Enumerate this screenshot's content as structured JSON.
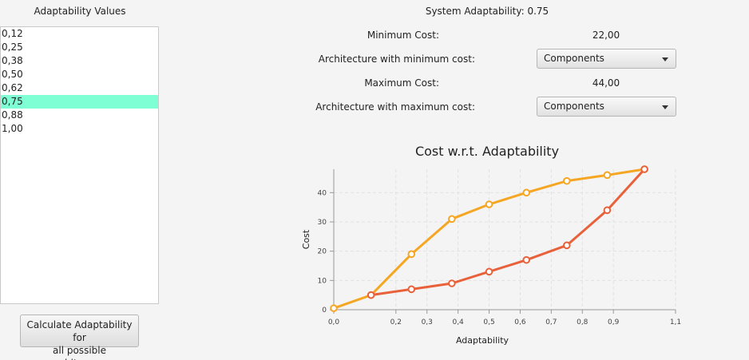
{
  "left": {
    "title": "Adaptability Values",
    "items": [
      "0,12",
      "0,25",
      "0,38",
      "0,50",
      "0,62",
      "0,75",
      "0,88",
      "1,00"
    ],
    "selected_index": 5,
    "selected_color": "#7fffd4",
    "button_label_line1": "Calculate Adaptability for",
    "button_label_line2": "all possible architecures"
  },
  "info": {
    "system_adaptability": "System Adaptability: 0.75",
    "min_cost_label": "Minimum Cost:",
    "min_cost_value": "22,00",
    "arch_min_label": "Architecture with minimum cost:",
    "arch_min_selected": "Components",
    "max_cost_label": "Maximum Cost:",
    "max_cost_value": "44,00",
    "arch_max_label": "Architecture with maximum cost:",
    "arch_max_selected": "Components"
  },
  "chart_data": {
    "type": "line",
    "title": "Cost w.r.t. Adaptability",
    "xlabel": "Adaptability",
    "ylabel": "Cost",
    "xlim": [
      0,
      1.1
    ],
    "ylim": [
      0,
      48
    ],
    "x_ticks": [
      "0,0",
      "0,2",
      "0,3",
      "0,4",
      "0,5",
      "0,6",
      "0,7",
      "0,8",
      "0,9",
      "1,1"
    ],
    "x_tick_values": [
      0,
      0.2,
      0.3,
      0.4,
      0.5,
      0.6,
      0.7,
      0.8,
      0.9,
      1.1
    ],
    "y_ticks": [
      0,
      10,
      20,
      30,
      40
    ],
    "grid": true,
    "series": [
      {
        "color": "#f5a623",
        "x": [
          0,
          0.12,
          0.25,
          0.38,
          0.5,
          0.62,
          0.75,
          0.88,
          1.0
        ],
        "values": [
          0.5,
          5,
          19,
          31,
          36,
          40,
          44,
          46,
          48
        ]
      },
      {
        "color": "#e8613a",
        "x": [
          0.12,
          0.25,
          0.38,
          0.5,
          0.62,
          0.75,
          0.88,
          1.0
        ],
        "values": [
          5,
          7,
          9,
          13,
          17,
          22,
          34,
          48
        ]
      }
    ]
  }
}
